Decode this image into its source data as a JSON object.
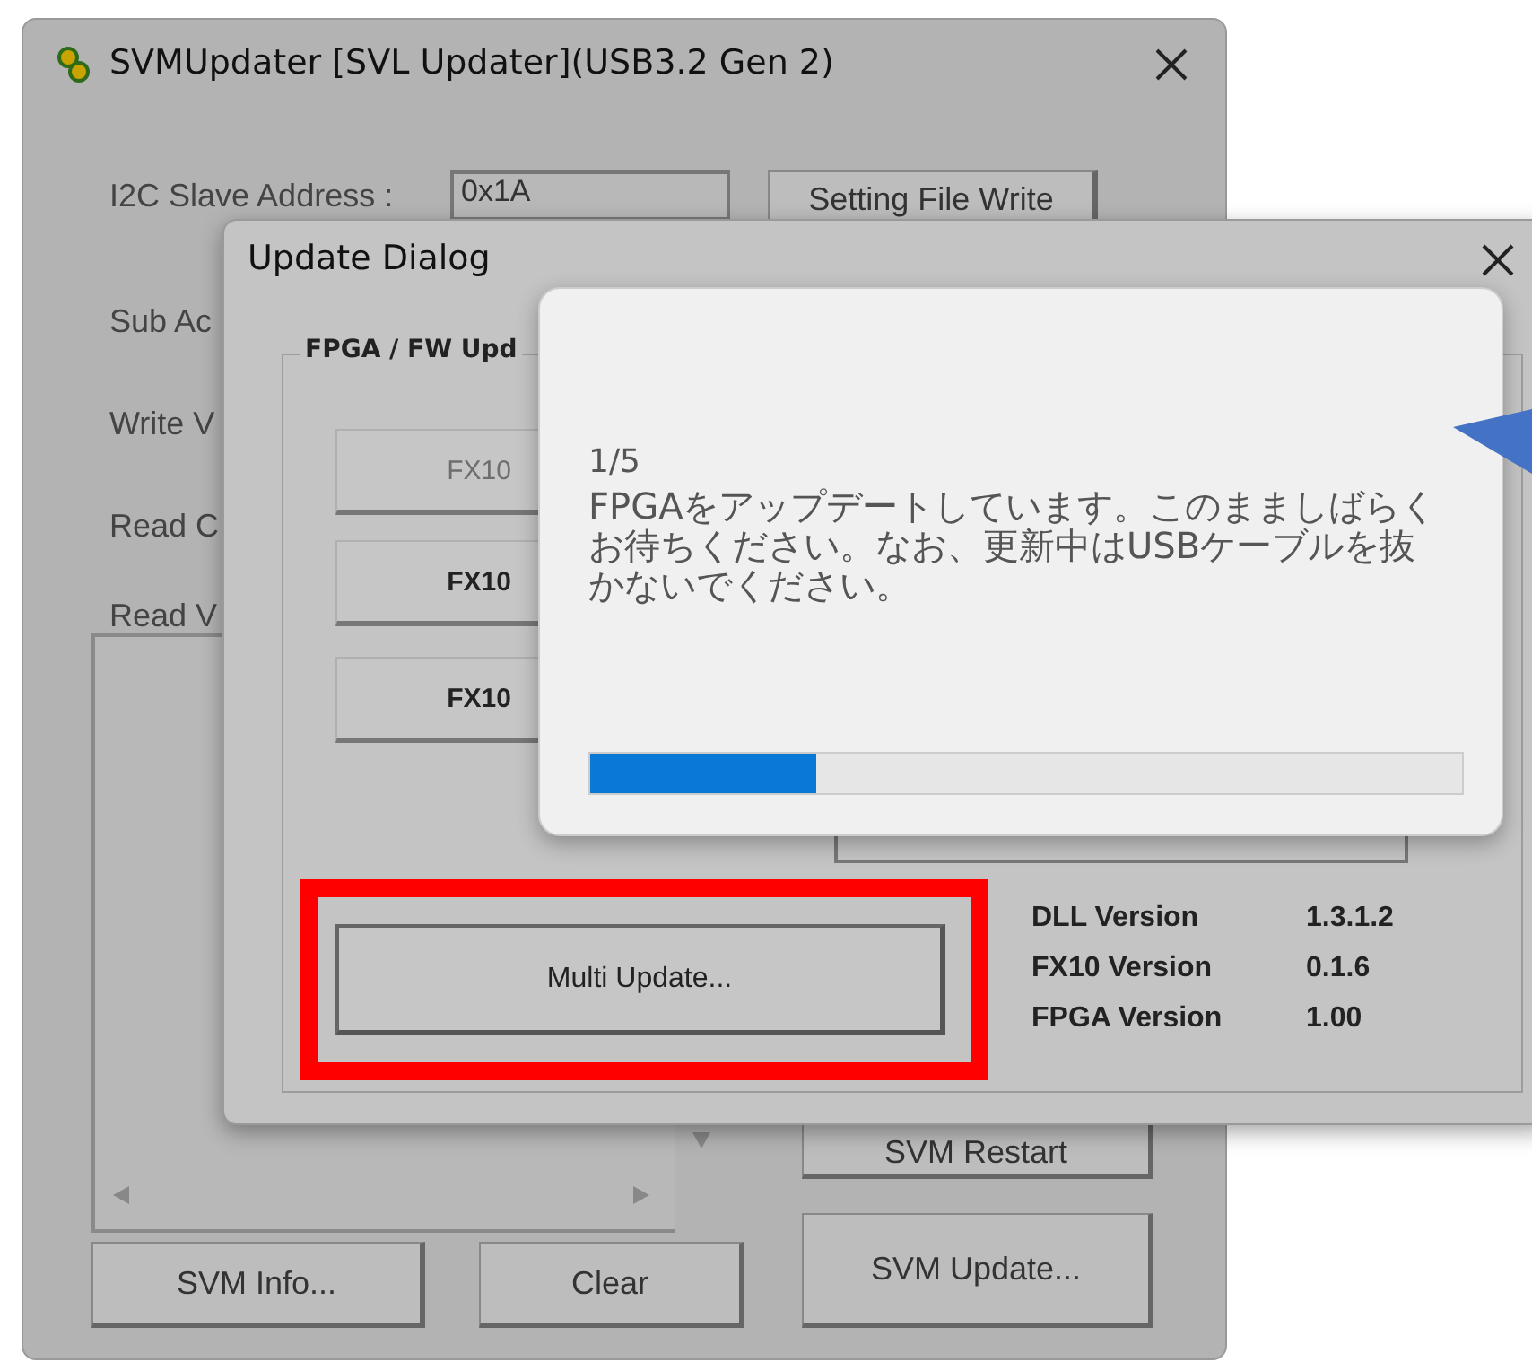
{
  "main_window": {
    "title": "SVMUpdater [SVL Updater](USB3.2 Gen 2)",
    "i2c_label": "I2C Slave Address :",
    "i2c_value": "0x1A",
    "setting_button": "Setting File Write",
    "labels": [
      "Sub Ac",
      "Write V",
      "Read C",
      "Read V"
    ],
    "restart_button": "SVM Restart",
    "update_button": "SVM Update...",
    "info_button": "SVM Info...",
    "clear_button": "Clear"
  },
  "update_dialog": {
    "title": "Update Dialog",
    "group": "FPGA / FW Upd",
    "buttons": [
      {
        "label": "FX10",
        "disabled": true
      },
      {
        "label": "FX10",
        "disabled": false
      },
      {
        "label": "FX10",
        "disabled": false
      }
    ],
    "multi_button": "Multi Update...",
    "versions": [
      {
        "name": "DLL Version",
        "value": "1.3.1.2"
      },
      {
        "name": "FX10 Version",
        "value": "0.1.6"
      },
      {
        "name": "FPGA Version",
        "value": "1.00"
      }
    ]
  },
  "progress_popup": {
    "step": "1/5",
    "message": "FPGAをアップデートしています。このまましばらくお待ちください。なお、更新中はUSBケーブルを抜かないでください。",
    "level": 0.26
  }
}
